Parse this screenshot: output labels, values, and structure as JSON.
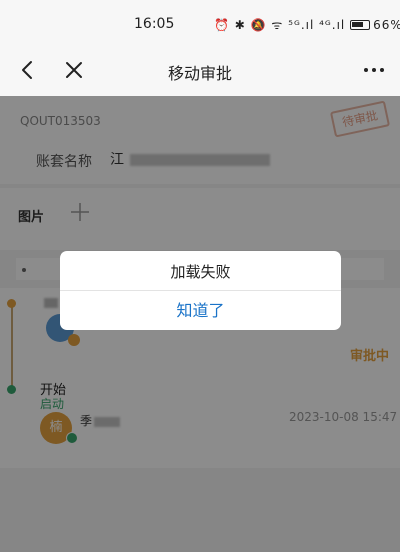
{
  "status_bar": {
    "time": "16:05",
    "indicators": "⏰ ✱ 🔕 ᯤ ⁵ᴳ.ıl ⁴ᴳ.ıl",
    "battery": "66%"
  },
  "nav": {
    "title": "移动审批",
    "back_icon": "chevron-left-icon",
    "close_icon": "close-icon",
    "more_icon": "more-horizontal-icon"
  },
  "document": {
    "number": "QOUT013503",
    "stamp": "待审批",
    "account_label": "账套名称",
    "account_value": "江",
    "images_label": "图片",
    "add_icon": "plus-icon"
  },
  "timeline": {
    "approving_status": "审批中",
    "start_label": "开始",
    "launch_label": "启动",
    "avatar_char": "楠",
    "person": "季",
    "time": "2023-10-08 15:47"
  },
  "dialog": {
    "message": "加载失败",
    "button": "知道了"
  },
  "colors": {
    "accent_blue": "#1a73c8",
    "pending_orange": "#e5a240",
    "done_green": "#3aa76d",
    "stamp_red": "#e6a088"
  }
}
